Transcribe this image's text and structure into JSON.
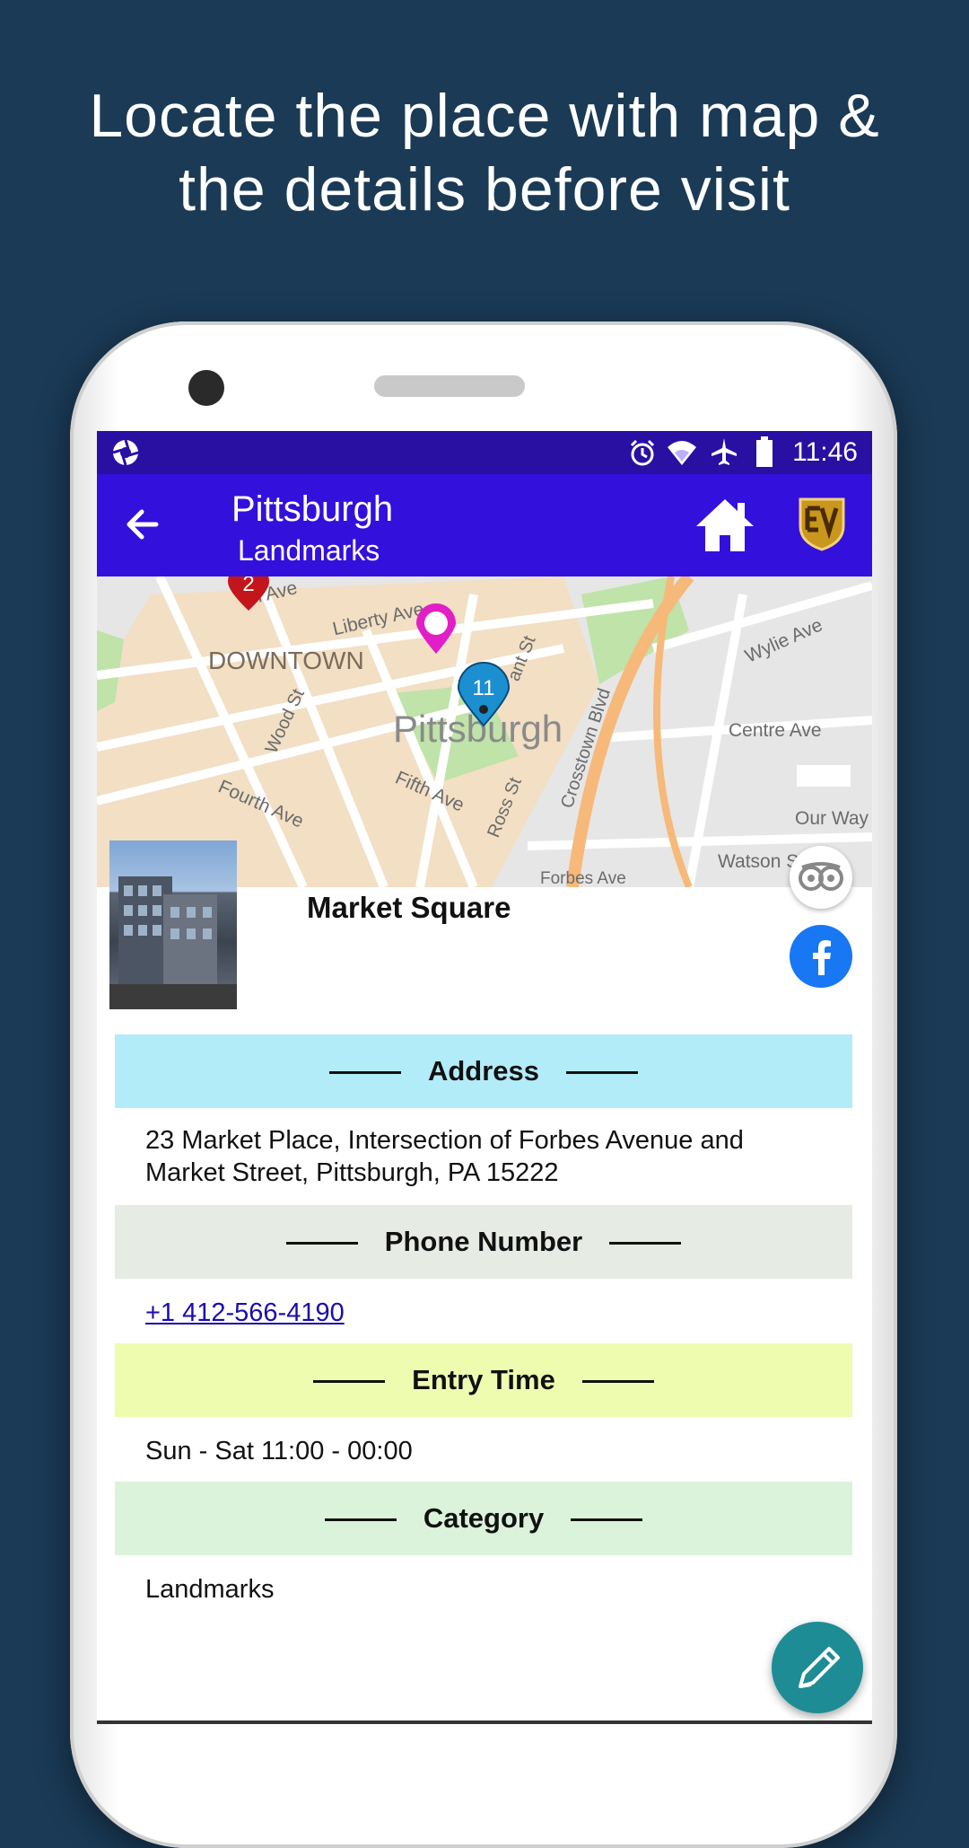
{
  "promo": {
    "line1": "Locate the place with map &",
    "line2": "the details before visit"
  },
  "status_bar": {
    "time": "11:46",
    "icons": [
      "aperture-icon",
      "alarm-icon",
      "wifi-icon",
      "airplane-icon",
      "battery-icon"
    ]
  },
  "app_bar": {
    "title": "Pittsburgh",
    "subtitle": "Landmarks",
    "accent_color": "#3410dc",
    "status_color": "#2a0fa3"
  },
  "map": {
    "labels": {
      "downtown": "DOWNTOWN",
      "city": "Pittsburgh",
      "liberty": "Liberty Ave",
      "penn": "nn Ave",
      "wood": "Wood St",
      "fourth": "Fourth Ave",
      "fifth": "Fifth Ave",
      "ross": "Ross St",
      "grant": "ant St",
      "crosstown": "Crosstown Blvd",
      "wylie": "Wylie Ave",
      "centre": "Centre Ave",
      "ourway": "Our Way",
      "watson": "Watson S",
      "forbes": "Forbes Ave"
    },
    "markers": {
      "red_count": "2",
      "blue_count": "11"
    }
  },
  "place": {
    "name": "Market Square"
  },
  "sections": {
    "address": {
      "heading": "Address",
      "line1": "23 Market Place, Intersection of Forbes Avenue and",
      "line2": "Market Street, Pittsburgh, PA 15222",
      "color": "#b3ecf9"
    },
    "phone": {
      "heading": "Phone Number",
      "value": "+1 412-566-4190",
      "color": "#e6ebe3"
    },
    "entry": {
      "heading": "Entry Time",
      "value": "Sun - Sat 11:00 - 00:00",
      "color": "#eefcb0"
    },
    "category": {
      "heading": "Category",
      "value": "Landmarks",
      "color": "#dbf3da"
    }
  }
}
